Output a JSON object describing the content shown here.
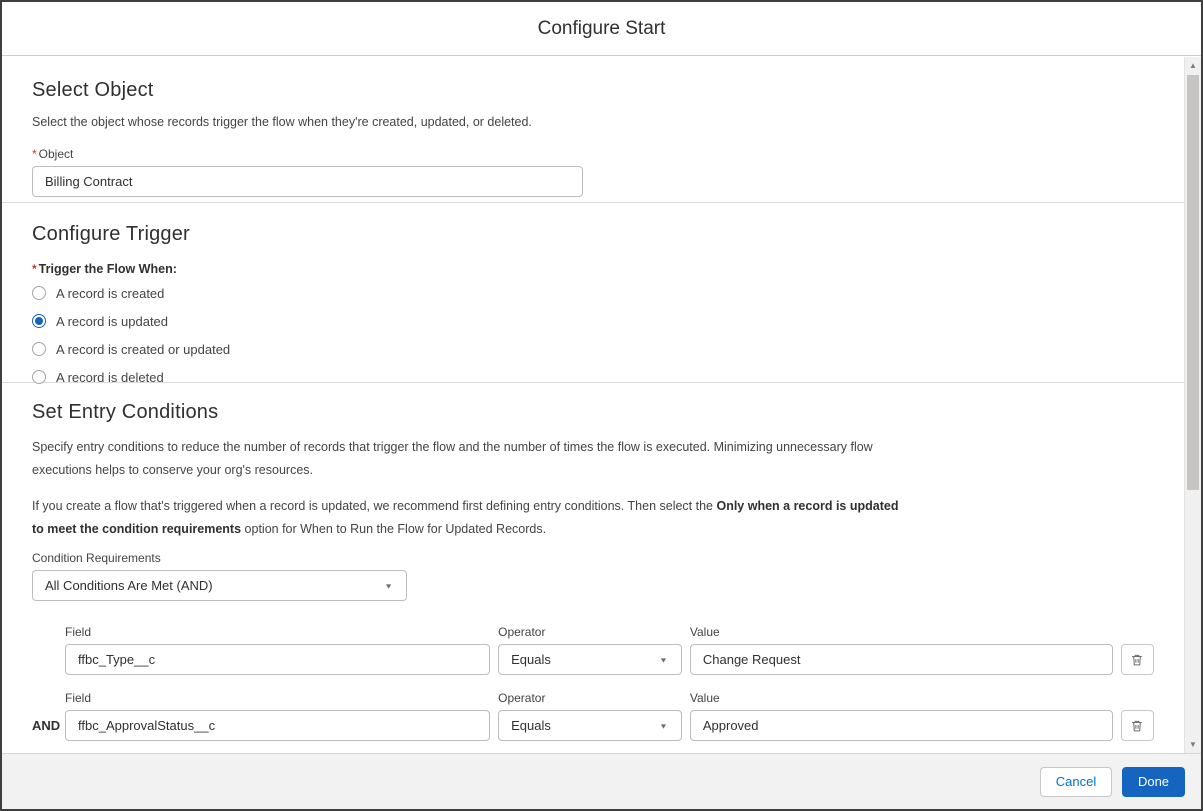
{
  "dialog": {
    "title": "Configure Start"
  },
  "colors": {
    "accent_blue": "#1565c0",
    "link_blue": "#0070d2",
    "required_red": "#c23934",
    "footer_bg": "#f3f2f2",
    "divider": "#dddbda"
  },
  "icons": {
    "dropdown_arrow": "▼",
    "scroll_up": "▲",
    "scroll_down": "▼"
  },
  "select_object": {
    "heading": "Select Object",
    "description": "Select the object whose records trigger the flow when they're created, updated, or deleted.",
    "required_mark": "*",
    "object_label": "Object",
    "object_value": "Billing Contract"
  },
  "configure_trigger": {
    "heading": "Configure Trigger",
    "required_mark": "*",
    "trigger_label": "Trigger the Flow When:",
    "options": [
      {
        "label": "A record is created",
        "selected": false
      },
      {
        "label": "A record is updated",
        "selected": true
      },
      {
        "label": "A record is created or updated",
        "selected": false
      },
      {
        "label": "A record is deleted",
        "selected": false
      }
    ]
  },
  "entry_conditions": {
    "heading": "Set Entry Conditions",
    "paragraph1": "Specify entry conditions to reduce the number of records that trigger the flow and the number of times the flow is executed. Minimizing unnecessary flow executions helps to conserve your org's resources.",
    "paragraph2_prefix": "If you create a flow that's triggered when a record is updated, we recommend first defining entry conditions. Then select the ",
    "paragraph2_bold": "Only when a record is updated to meet the condition requirements",
    "paragraph2_suffix": " option for When to Run the Flow for Updated Records.",
    "condition_requirements_label": "Condition Requirements",
    "condition_requirements_value": "All Conditions Are Met (AND)",
    "field_label": "Field",
    "operator_label": "Operator",
    "value_label": "Value",
    "and_label": "AND",
    "conditions": [
      {
        "field": "ffbc_Type__c",
        "operator": "Equals",
        "value": "Change Request"
      },
      {
        "field": "ffbc_ApprovalStatus__c",
        "operator": "Equals",
        "value": "Approved"
      }
    ]
  },
  "footer": {
    "cancel_label": "Cancel",
    "done_label": "Done"
  }
}
